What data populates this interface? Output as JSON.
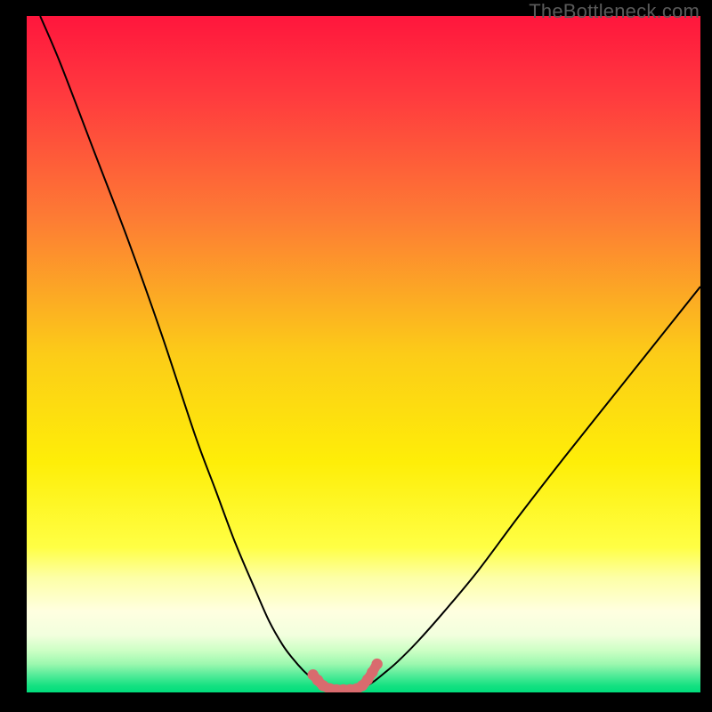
{
  "watermark": "TheBottleneck.com",
  "chart_data": {
    "type": "line",
    "title": "",
    "xlabel": "",
    "ylabel": "",
    "xlim": [
      0,
      100
    ],
    "ylim": [
      0,
      100
    ],
    "series": [
      {
        "name": "left-curve",
        "x": [
          2,
          5,
          10,
          15,
          20,
          25,
          28,
          31,
          34,
          36,
          38,
          39.5,
          41,
          42.2,
          43,
          43.8
        ],
        "y": [
          100,
          93,
          80,
          67,
          53,
          38,
          30,
          22,
          15,
          10.5,
          7,
          5,
          3.3,
          2.2,
          1.5,
          1.0
        ],
        "style": "black-thin"
      },
      {
        "name": "right-curve",
        "x": [
          50.5,
          51.5,
          53,
          55,
          58,
          62,
          67,
          73,
          80,
          88,
          96,
          100
        ],
        "y": [
          1.0,
          1.6,
          2.8,
          4.5,
          7.5,
          12,
          18,
          26,
          35,
          45,
          55,
          60
        ],
        "style": "black-thin"
      },
      {
        "name": "highlighted-basin",
        "x": [
          42.5,
          43.2,
          44.0,
          45.0,
          46.0,
          47.0,
          48.0,
          49.0,
          49.8,
          50.6,
          51.3,
          52.0
        ],
        "y": [
          2.6,
          1.8,
          1.0,
          0.55,
          0.4,
          0.4,
          0.42,
          0.55,
          1.0,
          1.9,
          3.0,
          4.2
        ],
        "style": "salmon-thick-dotted"
      }
    ],
    "background_gradient": {
      "stops": [
        {
          "offset": 0.0,
          "color": "#ff163d"
        },
        {
          "offset": 0.12,
          "color": "#ff3b3e"
        },
        {
          "offset": 0.3,
          "color": "#fd7c34"
        },
        {
          "offset": 0.5,
          "color": "#fccc18"
        },
        {
          "offset": 0.66,
          "color": "#feee08"
        },
        {
          "offset": 0.785,
          "color": "#ffff44"
        },
        {
          "offset": 0.83,
          "color": "#fdffa6"
        },
        {
          "offset": 0.88,
          "color": "#ffffe0"
        },
        {
          "offset": 0.915,
          "color": "#f2ffde"
        },
        {
          "offset": 0.938,
          "color": "#cdffc5"
        },
        {
          "offset": 0.958,
          "color": "#9cf8af"
        },
        {
          "offset": 0.975,
          "color": "#52eb98"
        },
        {
          "offset": 0.99,
          "color": "#15e181"
        },
        {
          "offset": 1.0,
          "color": "#00dd7c"
        }
      ]
    }
  }
}
